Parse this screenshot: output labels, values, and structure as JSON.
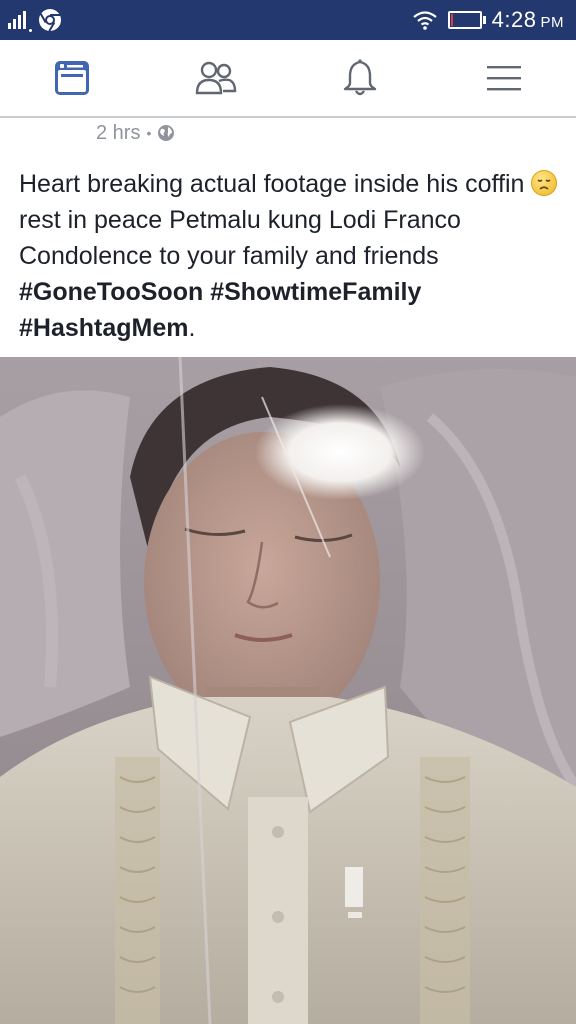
{
  "status_bar": {
    "time": "4:28",
    "ampm": "PM",
    "icons": [
      "signal-icon",
      "chrome-icon",
      "wifi-icon",
      "battery-icon"
    ],
    "battery_level_percent": 5
  },
  "nav_bar": {
    "items": [
      {
        "icon": "news-feed-icon",
        "active": true
      },
      {
        "icon": "friends-icon",
        "active": false
      },
      {
        "icon": "notifications-bell-icon",
        "active": false
      },
      {
        "icon": "menu-icon",
        "active": false
      }
    ],
    "accent_color": "#4267b2"
  },
  "post": {
    "timestamp": "2 hrs",
    "separator": "•",
    "audience_icon": "globe-icon",
    "text_part1": "Heart breaking actual footage inside his coffin",
    "emoji": "disappointed-face-emoji",
    "text_part2": "rest in peace Petmalu kung Lodi Franco Condolence to your family and friends",
    "hashtags": [
      "#GoneTooSoon",
      "#ShowtimeFamily",
      "#HashtagMem"
    ],
    "trailing": ".",
    "photo": {
      "description_icon": "photo-attachment"
    }
  }
}
